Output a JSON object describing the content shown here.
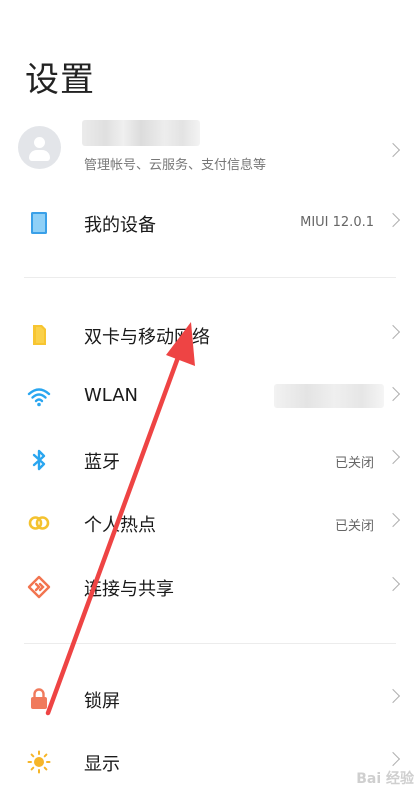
{
  "header": {
    "title": "设置"
  },
  "account": {
    "subtitle": "管理帐号、云服务、支付信息等"
  },
  "device": {
    "label": "我的设备",
    "value": "MIUI 12.0.1"
  },
  "network": [
    {
      "id": "sim",
      "label": "双卡与移动网络",
      "value": "",
      "icon": "sim-card-icon"
    },
    {
      "id": "wlan",
      "label": "WLAN",
      "value": "",
      "icon": "wifi-icon"
    },
    {
      "id": "bluetooth",
      "label": "蓝牙",
      "value": "已关闭",
      "icon": "bluetooth-icon"
    },
    {
      "id": "hotspot",
      "label": "个人热点",
      "value": "已关闭",
      "icon": "hotspot-icon"
    },
    {
      "id": "share",
      "label": "连接与共享",
      "value": "",
      "icon": "share-icon"
    }
  ],
  "personal": [
    {
      "id": "lock",
      "label": "锁屏",
      "icon": "lock-icon"
    },
    {
      "id": "display",
      "label": "显示",
      "icon": "sun-icon"
    }
  ],
  "watermark": "Bai 经验",
  "colors": {
    "sim": "#f7c531",
    "wifi": "#2aa6f0",
    "bluetooth": "#2aa6f0",
    "hotspot": "#f4c22f",
    "share": "#f2744f",
    "lock": "#f07a5c",
    "display": "#f6b528",
    "device": "#3aa0e8",
    "arrow": "#ee4444"
  }
}
